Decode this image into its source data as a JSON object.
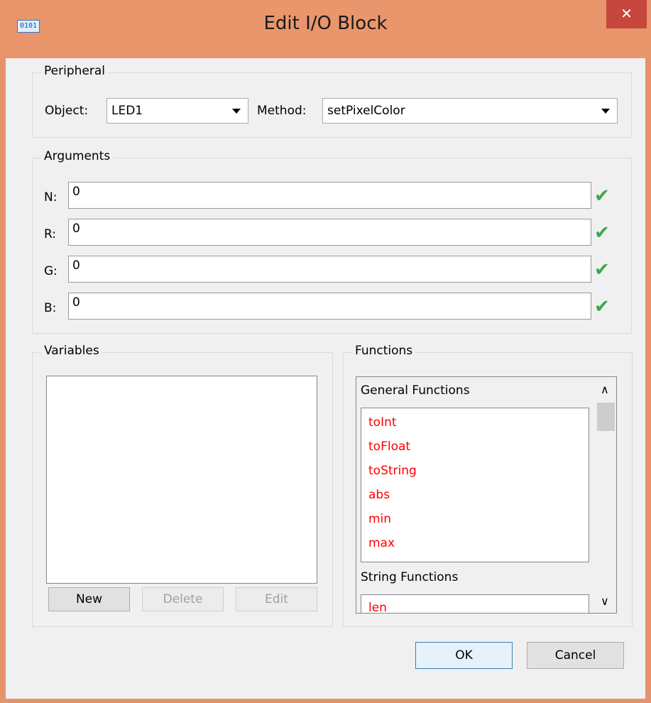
{
  "window": {
    "title": "Edit I/O Block",
    "icon_text": "0101",
    "close_glyph": "✕"
  },
  "peripheral": {
    "legend": "Peripheral",
    "object_label": "Object:",
    "object_value": "LED1",
    "method_label": "Method:",
    "method_value": "setPixelColor"
  },
  "arguments": {
    "legend": "Arguments",
    "items": [
      {
        "label": "N:",
        "value": "0",
        "valid": true
      },
      {
        "label": "R:",
        "value": "0",
        "valid": true
      },
      {
        "label": "G:",
        "value": "0",
        "valid": true
      },
      {
        "label": "B:",
        "value": "0",
        "valid": true
      }
    ],
    "check_glyph": "✔",
    "check_color": "#3fa64a"
  },
  "variables": {
    "legend": "Variables",
    "new_label": "New",
    "delete_label": "Delete",
    "edit_label": "Edit"
  },
  "functions": {
    "legend": "Functions",
    "general_title": "General Functions",
    "general_items": [
      "toInt",
      "toFloat",
      "toString",
      "abs",
      "min",
      "max"
    ],
    "string_title": "String Functions",
    "string_items": [
      "len"
    ],
    "item_color": "#ff0000",
    "scroll_up_glyph": "∧",
    "scroll_down_glyph": "∨"
  },
  "footer": {
    "ok_label": "OK",
    "cancel_label": "Cancel"
  },
  "colors": {
    "frame": "#e9966c",
    "close_button": "#c7463d",
    "client_bg": "#f0f0f0"
  }
}
